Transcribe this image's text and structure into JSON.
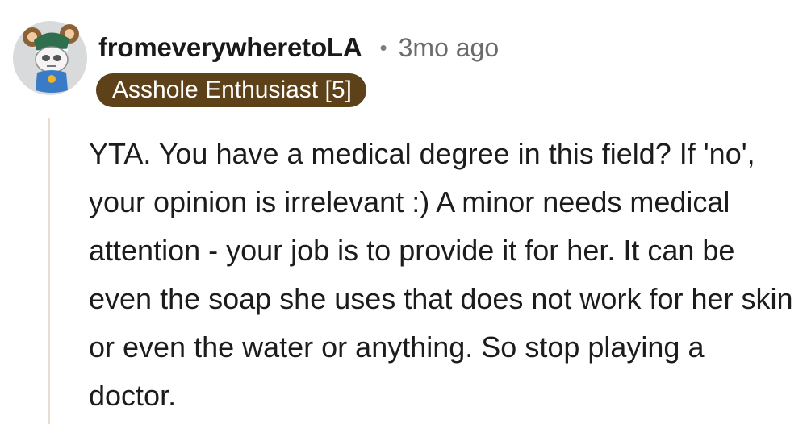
{
  "comment": {
    "author": "fromeverywheretoLA",
    "separator": "•",
    "timestamp": "3mo ago",
    "flair": "Asshole Enthusiast [5]",
    "flair_color": "#5c4119",
    "thread_line_color": "#e7dccf",
    "body": "YTA. You have a medical degree in this field? If 'no', your opinion is irrelevant :) A minor needs medical attention - your job is to provide it for her. It can be even the soap she uses that does not work for her skin or even the water or anything. So stop playing a doctor.",
    "avatar_icon": "snoo-avatar-icon"
  }
}
